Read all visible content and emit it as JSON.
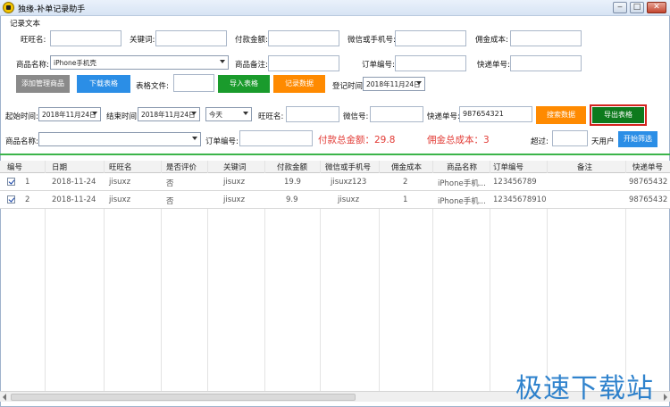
{
  "window": {
    "title": "独缘-补单记录助手",
    "minimize": "‒",
    "maximize": "□",
    "close": "✕"
  },
  "record_group": {
    "label": "记录文本",
    "wangwang_label": "旺旺名:",
    "keyword_label": "关键词:",
    "pay_amount_label": "付款金额:",
    "wechat_phone_label": "微信或手机号:",
    "commission_label": "佣金成本:",
    "product_name_label": "商品名称:",
    "product_select_value": "iPhone手机壳",
    "product_note_label": "商品备注:",
    "order_no_label": "订单编号:",
    "express_no_label": "快递单号:",
    "add_product_button": "添加管理商品",
    "download_table_button": "下载表格",
    "table_file_label": "表格文件:",
    "import_table_button": "导入表格",
    "record_data_button": "记录数据",
    "register_time_label": "登记时间:",
    "register_time_value": "2018年11月24日"
  },
  "search_group": {
    "start_time_label": "起始时间:",
    "start_time_value": "2018年11月24日",
    "end_time_label": "结束时间:",
    "end_time_value": "2018年11月24日",
    "period_value": "今天",
    "wangwang_label": "旺旺名:",
    "wechat_label": "微信号:",
    "express_no_label": "快递单号:",
    "express_no_value": "987654321",
    "search_button": "搜索数据",
    "export_button": "导出表格",
    "product_name_label": "商品名称:",
    "order_no_label": "订单编号:",
    "total_pay_text": "付款总金额：29.8",
    "total_commission_text": "佣金总成本：3",
    "exceed_label": "超过:",
    "days_user_label": "天用户",
    "start_filter_button": "开始筛选"
  },
  "table": {
    "columns": [
      "编号",
      "日期",
      "旺旺名",
      "是否评价",
      "关键词",
      "付款金额",
      "微信或手机号",
      "佣金成本",
      "商品名称",
      "订单编号",
      "备注",
      "快递单号"
    ],
    "rows": [
      {
        "id": "1",
        "date": "2018-11-24",
        "wangwang": "jisuxz",
        "reviewed": "否",
        "keyword": "jisuxz",
        "amount": "19.9",
        "wechat": "jisuxz123",
        "commission": "2",
        "product": "iPhone手机...",
        "order_no": "123456789",
        "note": "",
        "express": "98765432"
      },
      {
        "id": "2",
        "date": "2018-11-24",
        "wangwang": "jisuxz",
        "reviewed": "否",
        "keyword": "jisuxz",
        "amount": "9.9",
        "wechat": "jisuxz",
        "commission": "1",
        "product": "iPhone手机...",
        "order_no": "12345678910",
        "note": "",
        "express": "98765432"
      }
    ]
  },
  "watermark": "极速下载站",
  "colors": {
    "accent_green": "#3cb54a",
    "total_red": "#e23a34",
    "button_blue": "#2b8ee6",
    "button_orange": "#ff8a00"
  }
}
